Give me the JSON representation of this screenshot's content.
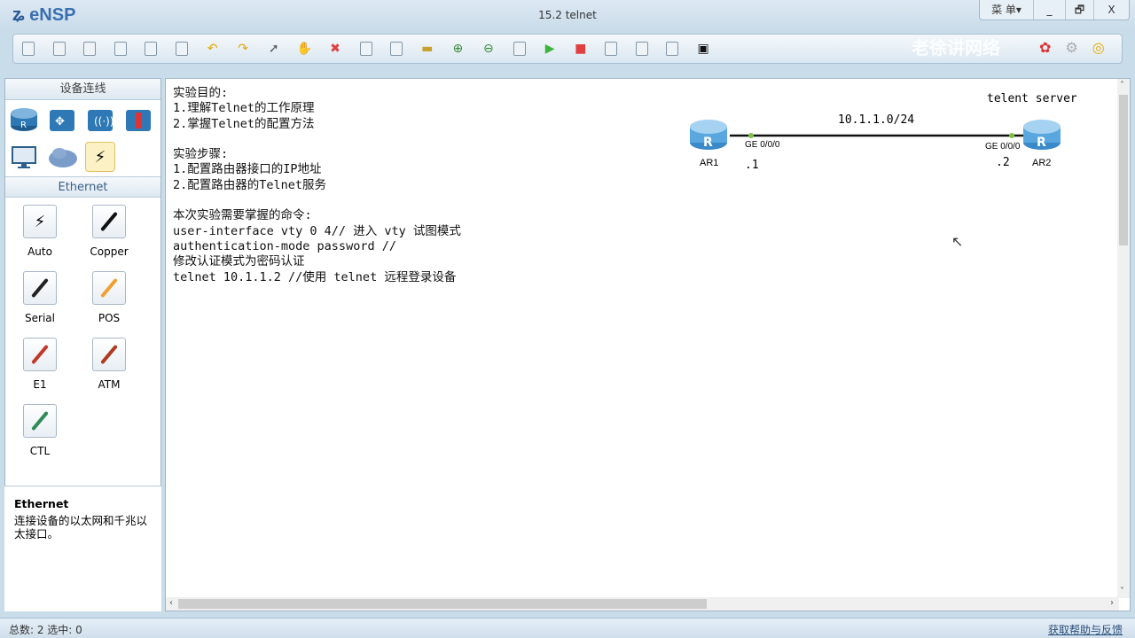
{
  "app": {
    "name": "eNSP",
    "window_title": "15.2 telnet",
    "menu_label": "菜 单▾",
    "minimize": "_",
    "restore": "🗗",
    "close": "X",
    "watermark": "老徐讲网络"
  },
  "toolbar": [
    "new-topology",
    "new-blank",
    "open",
    "save",
    "save-as",
    "print",
    "undo",
    "redo",
    "select",
    "pan",
    "delete",
    "delete-link",
    "text-note",
    "palette",
    "zoom-in",
    "zoom-out",
    "fit",
    "start",
    "stop",
    "capture",
    "topology",
    "grid",
    "console"
  ],
  "sidebar": {
    "device_header": "设备连线",
    "cable_header": "Ethernet",
    "devices": [
      "router",
      "switch",
      "wireless",
      "firewall",
      "pc",
      "cloud",
      "connection"
    ],
    "cables": [
      {
        "label": "Auto",
        "color": "#111111"
      },
      {
        "label": "Copper",
        "color": "#111111"
      },
      {
        "label": "Serial",
        "color": "#222222"
      },
      {
        "label": "POS",
        "color": "#f0a030"
      },
      {
        "label": "E1",
        "color": "#c0392b"
      },
      {
        "label": "ATM",
        "color": "#b03a20"
      },
      {
        "label": "CTL",
        "color": "#2e8b57"
      }
    ],
    "desc_title": "Ethernet",
    "desc_text": "连接设备的以太网和千兆以太接口。"
  },
  "canvas": {
    "notes": [
      "实验目的:",
      "1.理解Telnet的工作原理",
      "2.掌握Telnet的配置方法",
      "",
      "实验步骤:",
      "1.配置路由器接口的IP地址",
      "2.配置路由器的Telnet服务",
      "",
      "本次实验需要掌握的命令:",
      "user-interface vty 0 4// 进入 vty 试图模式",
      "authentication-mode password //",
      "修改认证模式为密码认证",
      "telnet 10.1.1.2 //使用 telnet 远程登录设备"
    ],
    "topology": {
      "network": "10.1.1.0/24",
      "server_label": "telent server",
      "ar1": {
        "name": "AR1",
        "port": "GE 0/0/0",
        "ip": ".1"
      },
      "ar2": {
        "name": "AR2",
        "port": "GE 0/0/0",
        "ip": ".2"
      },
      "link_color": "#111111",
      "port_color": "#7cc242"
    }
  },
  "status": {
    "left": "总数: 2  选中: 0",
    "help_link": "获取帮助与反馈"
  }
}
